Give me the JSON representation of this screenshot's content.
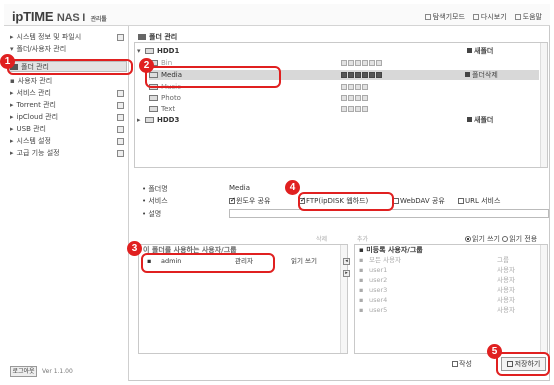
{
  "header": {
    "logo_brand": "ipTIME",
    "logo_product": "NAS I",
    "logo_suffix": "관리툴",
    "links": [
      "탐색기모드",
      "다시보기",
      "도움말"
    ]
  },
  "sidebar": {
    "items": [
      {
        "label": "시스템 정보 및 파일시",
        "state": "normal"
      },
      {
        "label": "폴더/사용자 관리",
        "state": "covered"
      },
      {
        "label": "폴더 관리",
        "state": "active"
      },
      {
        "label": "사용자 관리",
        "state": "covered"
      },
      {
        "label": "서비스 관리",
        "state": "normal"
      },
      {
        "label": "Torrent 관리",
        "state": "normal"
      },
      {
        "label": "ipCloud 관리",
        "state": "normal"
      },
      {
        "label": "USB 관리",
        "state": "normal"
      },
      {
        "label": "시스템 설정",
        "state": "normal"
      },
      {
        "label": "고급 기능 설정",
        "state": "normal"
      }
    ],
    "logout_label": "로그아웃",
    "version": "Ver 1.1.00"
  },
  "folders": {
    "title": "폴더 관리",
    "tree": [
      {
        "label": "HDD1",
        "bold": true,
        "chevron": "▾",
        "action": "새폴더",
        "boxes": 0
      },
      {
        "label": "Bin",
        "bold": false,
        "chevron": "",
        "action": "",
        "boxes": 6,
        "faded": true
      },
      {
        "label": "Media",
        "bold": false,
        "chevron": "",
        "action": "폴더삭제",
        "boxes": 6,
        "selected": true
      },
      {
        "label": "Music",
        "bold": false,
        "chevron": "",
        "action": "",
        "boxes": 4,
        "faded": true
      },
      {
        "label": "Photo",
        "bold": false,
        "chevron": "",
        "action": "",
        "boxes": 4
      },
      {
        "label": "Text",
        "bold": false,
        "chevron": "",
        "action": "",
        "boxes": 4
      },
      {
        "label": "HDD3",
        "bold": true,
        "chevron": "▸",
        "action": "새폴더",
        "boxes": 0
      }
    ]
  },
  "properties": {
    "folder_label": "폴더명",
    "folder_value": "Media",
    "service_label": "서비스",
    "services": [
      {
        "label": "윈도우 공유",
        "checked": true
      },
      {
        "label": "FTP(ipDISK 웹하드)",
        "checked": true
      },
      {
        "label": "WebDAV 공유",
        "checked": false
      },
      {
        "label": "URL 서비스",
        "checked": false
      }
    ],
    "desc_label": "설명"
  },
  "permissions": {
    "left_header": "이 폴더를 사용하는 사용자/그룹",
    "right_header": "미등록 사용자/그룹",
    "mode_options": [
      {
        "label": "읽기 쓰기",
        "checked": true
      },
      {
        "label": "읽기 전용",
        "checked": false
      }
    ],
    "assigned": [
      {
        "name": "admin",
        "type": "관리자",
        "perm": "읽기 쓰기"
      }
    ],
    "unassigned": [
      {
        "name": "모든 사용자",
        "type": "그룹"
      },
      {
        "name": "user1",
        "type": "사용자"
      },
      {
        "name": "user2",
        "type": "사용자"
      },
      {
        "name": "user3",
        "type": "사용자"
      },
      {
        "name": "user4",
        "type": "사용자"
      },
      {
        "name": "user5",
        "type": "사용자"
      }
    ],
    "left_toolbar": "삭제",
    "right_toolbar": "추가"
  },
  "footer": {
    "write_label": "작성",
    "save_label": "저장하기"
  },
  "callouts": [
    "1",
    "2",
    "3",
    "4",
    "5"
  ],
  "colors": {
    "callout": "#e02020",
    "selection": "#d8d8d8"
  }
}
